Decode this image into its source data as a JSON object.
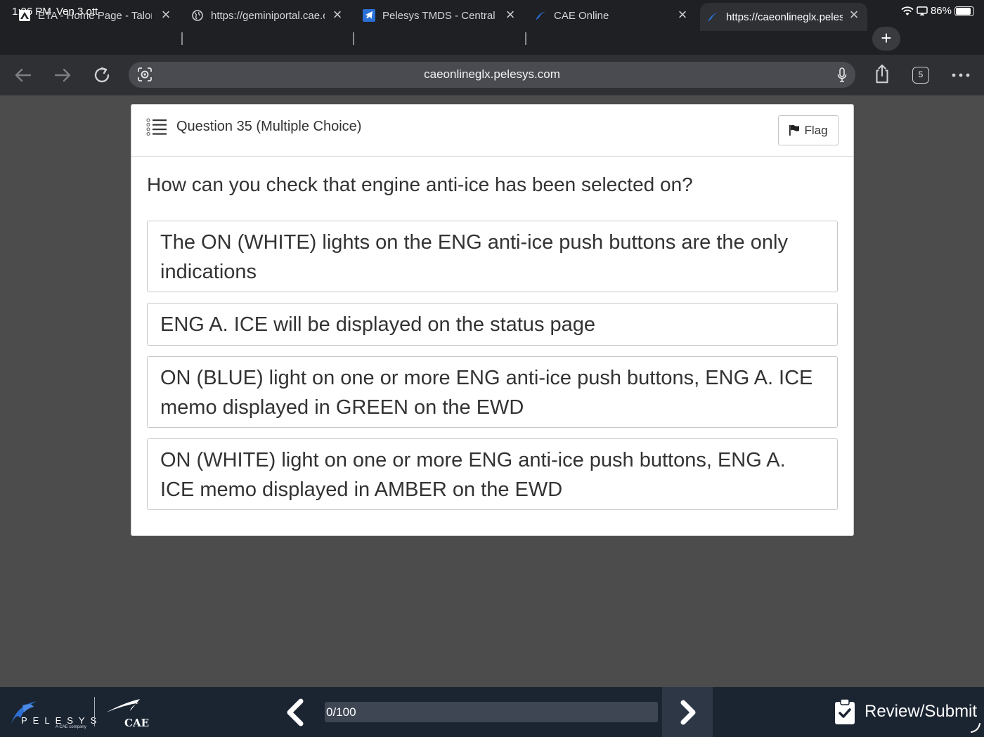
{
  "status_bar": {
    "time": "1:06 PM",
    "date": "Ven 3 ott",
    "battery_percent": "86%",
    "battery_level": 0.86
  },
  "tabs": [
    {
      "title": "ETA - Home Page - Talon",
      "favicon": "eta-icon",
      "active": false
    },
    {
      "title": "https://geminiportal.cae.com",
      "favicon": "globe-icon",
      "active": false
    },
    {
      "title": "Pelesys TMDS - Central",
      "favicon": "plane-icon",
      "active": false
    },
    {
      "title": "CAE Online",
      "favicon": "pelesys-icon",
      "active": false
    },
    {
      "title": "https://caeonlineglx.pelesys.com",
      "favicon": "pelesys-icon",
      "active": true
    }
  ],
  "toolbar": {
    "url": "caeonlineglx.pelesys.com",
    "tab_count": "5"
  },
  "question_card": {
    "title": "Question 35 (Multiple Choice)",
    "flag_label": "Flag",
    "question": "How can you check that engine anti-ice has been selected on?",
    "options": [
      "The ON (WHITE) lights on the ENG anti-ice push buttons are the only indications",
      "ENG A. ICE will be displayed on the status page",
      "ON (BLUE) light on one or more ENG anti-ice push buttons, ENG A. ICE memo displayed in GREEN on the EWD",
      "ON (WHITE) light on one or more ENG anti-ice push buttons, ENG A. ICE memo displayed in AMBER on the EWD"
    ]
  },
  "bottom_bar": {
    "brand": "PELESYS",
    "brand_sub": "A CAE company",
    "partner": "CAE",
    "progress_label": "0/100",
    "progress_fraction": 0.0,
    "review_label": "Review/Submit"
  },
  "colors": {
    "accent": "#5b93d3",
    "bottom_bar": "#1b2431",
    "page_bg": "#4c4c4d"
  }
}
